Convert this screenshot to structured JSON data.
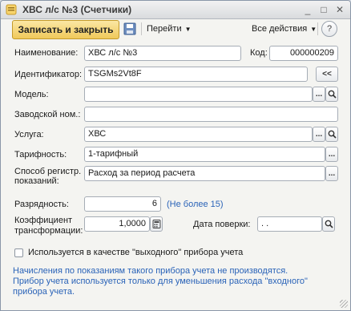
{
  "window": {
    "title": "ХВС л/с №3 (Счетчики)",
    "controls": {
      "minimize": "_",
      "maximize": "□",
      "close": "✕"
    }
  },
  "toolbar": {
    "save_close_label": "Записать и закрыть",
    "goto_label": "Перейти",
    "all_actions_label": "Все действия",
    "help_label": "?"
  },
  "form": {
    "name_label": "Наименование:",
    "name_value": "ХВС л/с №3",
    "code_label": "Код:",
    "code_value": "000000209",
    "id_label": "Идентификатор:",
    "id_value": "TSGMs2Vt8F",
    "id_btn": "<<",
    "model_label": "Модель:",
    "model_value": "",
    "serial_label": "Заводской ном.:",
    "serial_value": "",
    "service_label": "Услуга:",
    "service_value": "ХВС",
    "tariff_label": "Тарифность:",
    "tariff_value": "1-тарифный",
    "method_label_1": "Способ регистр.",
    "method_label_2": "показаний:",
    "method_value": "Расход за период расчета",
    "digits_label": "Разрядность:",
    "digits_value": "6",
    "digits_hint": "(Не более 15)",
    "coef_label_1": "Коэффициент",
    "coef_label_2": "трансформации:",
    "coef_value": "1,0000",
    "check_date_label": "Дата поверки:",
    "check_date_value": " .  .",
    "output_checkbox_label": "Используется в качестве \"выходного\" прибора учета",
    "output_checkbox_checked": false,
    "info_lines": [
      "Начисления по показаниям такого прибора учета не производятся.",
      "Прибор учета используется только для уменьшения расхода \"входного\"",
      "прибора учета."
    ],
    "select_btn": "...",
    "open_icon": "magnifier-icon"
  }
}
